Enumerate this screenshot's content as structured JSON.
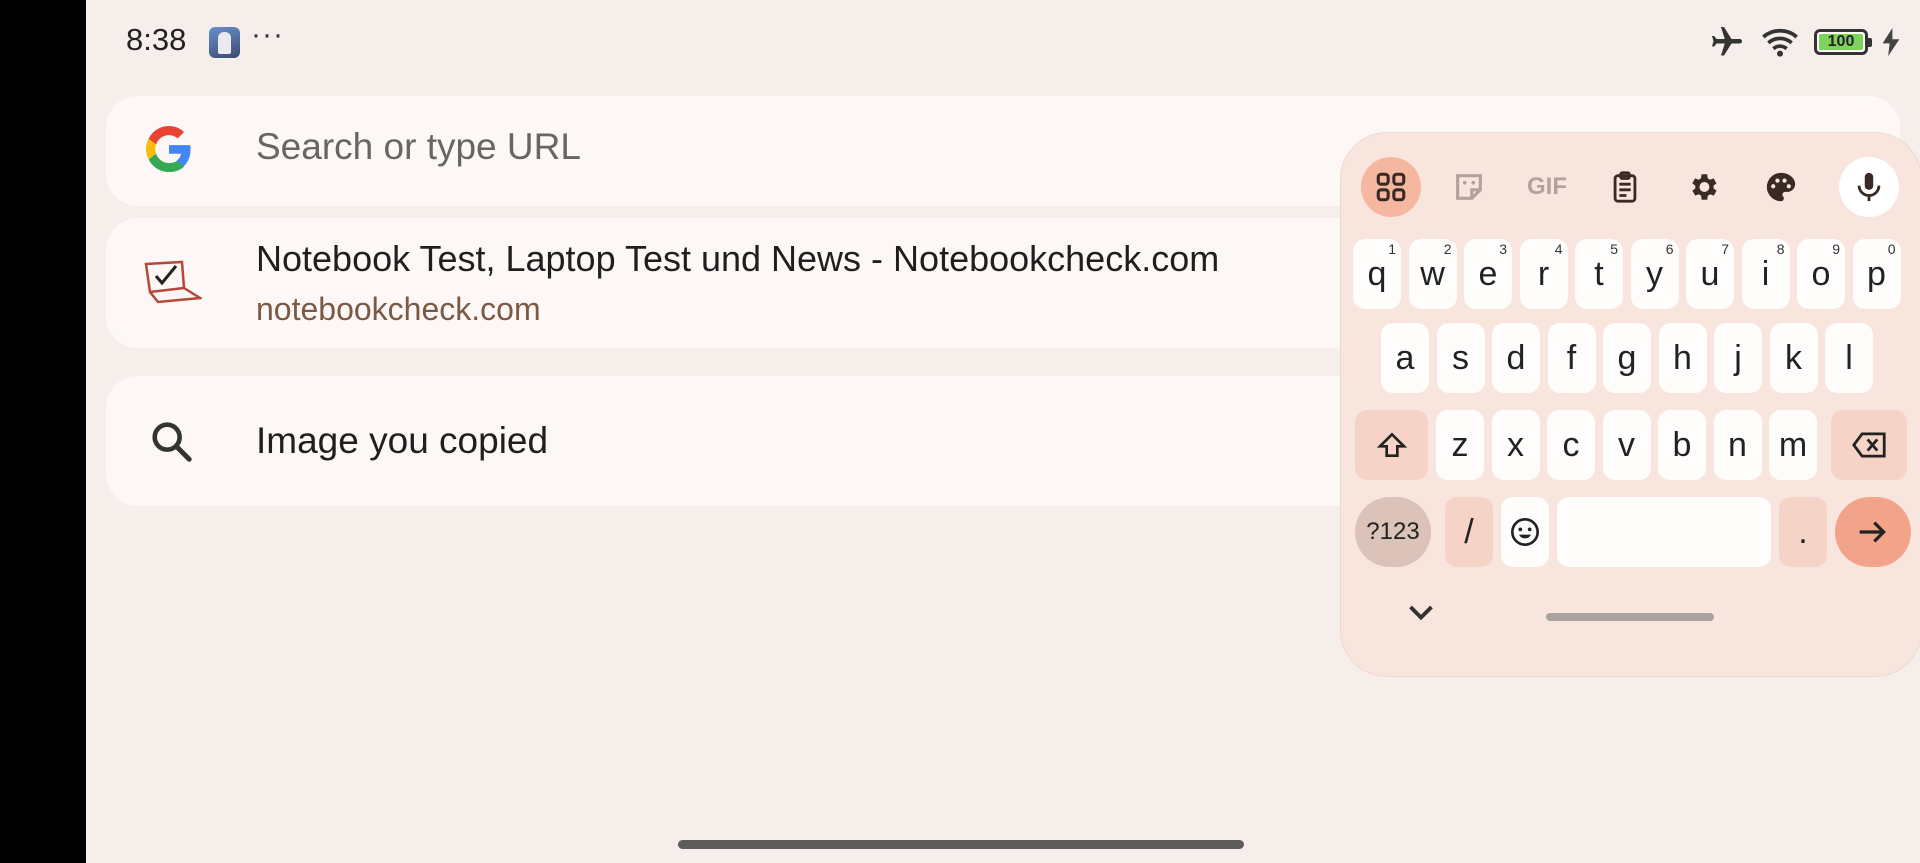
{
  "status_bar": {
    "time": "8:38",
    "more": "···",
    "battery_level": "100",
    "icons": [
      "airplane-mode-icon",
      "wifi-icon",
      "battery-icon",
      "charging-icon"
    ]
  },
  "search": {
    "placeholder": "Search or type URL"
  },
  "suggestions": [
    {
      "title": "Notebook Test, Laptop Test und News - Notebookcheck.com",
      "url": "notebookcheck.com",
      "icon": "notebookcheck-favicon"
    },
    {
      "title": "Image you copied",
      "icon": "search-icon"
    }
  ],
  "keyboard": {
    "toolbar": [
      "apps-grid-icon",
      "sticker-icon",
      "GIF",
      "clipboard-icon",
      "settings-icon",
      "theme-palette-icon",
      "mic-icon"
    ],
    "gif_label": "GIF",
    "row1": [
      {
        "k": "q",
        "n": "1"
      },
      {
        "k": "w",
        "n": "2"
      },
      {
        "k": "e",
        "n": "3"
      },
      {
        "k": "r",
        "n": "4"
      },
      {
        "k": "t",
        "n": "5"
      },
      {
        "k": "y",
        "n": "6"
      },
      {
        "k": "u",
        "n": "7"
      },
      {
        "k": "i",
        "n": "8"
      },
      {
        "k": "o",
        "n": "9"
      },
      {
        "k": "p",
        "n": "0"
      }
    ],
    "row2": [
      "a",
      "s",
      "d",
      "f",
      "g",
      "h",
      "j",
      "k",
      "l"
    ],
    "row3": [
      "z",
      "x",
      "c",
      "v",
      "b",
      "n",
      "m"
    ],
    "symbols_label": "?123",
    "slash_label": "/",
    "period_label": ".",
    "accent_color": "#f2a48a"
  }
}
